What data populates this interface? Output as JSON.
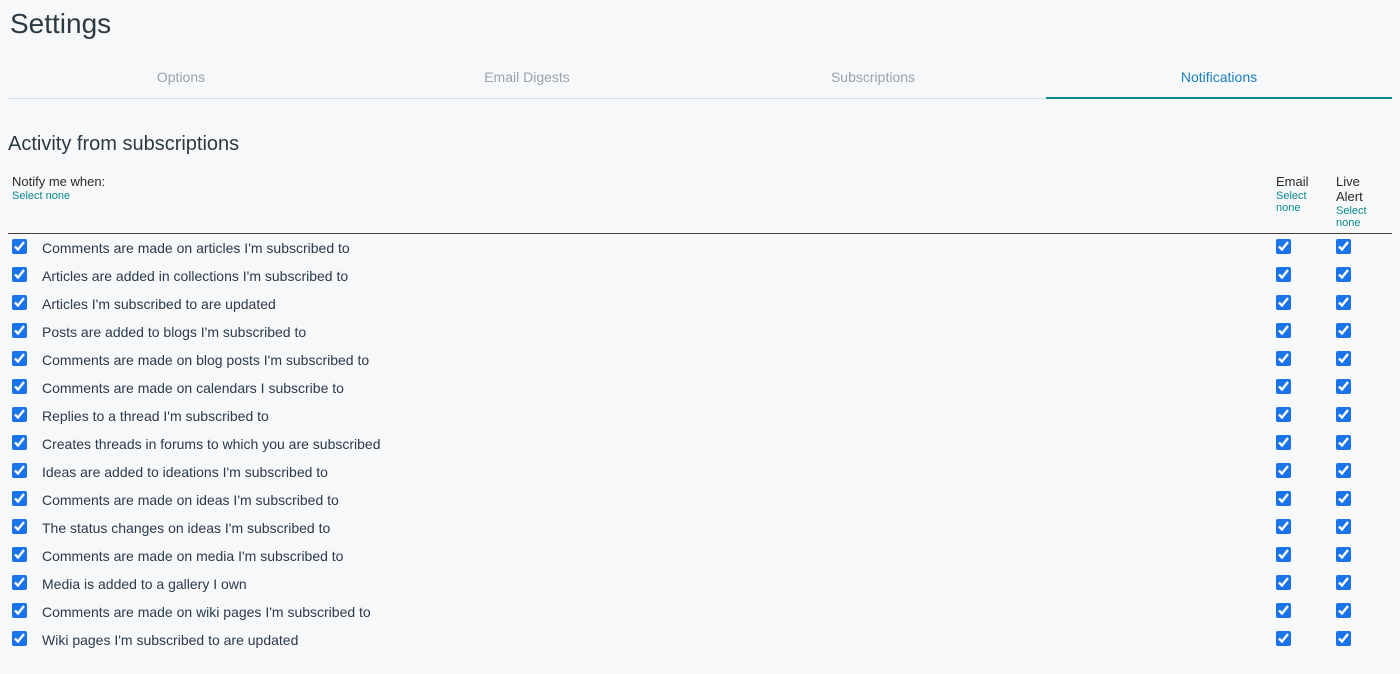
{
  "page_title": "Settings",
  "tabs": [
    {
      "label": "Options",
      "active": false
    },
    {
      "label": "Email Digests",
      "active": false
    },
    {
      "label": "Subscriptions",
      "active": false
    },
    {
      "label": "Notifications",
      "active": true
    }
  ],
  "section_title": "Activity from subscriptions",
  "header": {
    "notify_label": "Notify me when:",
    "email_label": "Email",
    "live_label": "Live Alert",
    "select_none": "Select none"
  },
  "rows": [
    {
      "label": "Comments are made on articles I'm subscribed to",
      "master": true,
      "email": true,
      "live": true
    },
    {
      "label": "Articles are added in collections I'm subscribed to",
      "master": true,
      "email": true,
      "live": true
    },
    {
      "label": "Articles I'm subscribed to are updated",
      "master": true,
      "email": true,
      "live": true
    },
    {
      "label": "Posts are added to blogs I'm subscribed to",
      "master": true,
      "email": true,
      "live": true
    },
    {
      "label": "Comments are made on blog posts I'm subscribed to",
      "master": true,
      "email": true,
      "live": true
    },
    {
      "label": "Comments are made on calendars I subscribe to",
      "master": true,
      "email": true,
      "live": true
    },
    {
      "label": "Replies to a thread I'm subscribed to",
      "master": true,
      "email": true,
      "live": true
    },
    {
      "label": "Creates threads in forums to which you are subscribed",
      "master": true,
      "email": true,
      "live": true
    },
    {
      "label": "Ideas are added to ideations I'm subscribed to",
      "master": true,
      "email": true,
      "live": true
    },
    {
      "label": "Comments are made on ideas I'm subscribed to",
      "master": true,
      "email": true,
      "live": true
    },
    {
      "label": "The status changes on ideas I'm subscribed to",
      "master": true,
      "email": true,
      "live": true
    },
    {
      "label": "Comments are made on media I'm subscribed to",
      "master": true,
      "email": true,
      "live": true
    },
    {
      "label": "Media is added to a gallery I own",
      "master": true,
      "email": true,
      "live": true
    },
    {
      "label": "Comments are made on wiki pages I'm subscribed to",
      "master": true,
      "email": true,
      "live": true
    },
    {
      "label": "Wiki pages I'm subscribed to are updated",
      "master": true,
      "email": true,
      "live": true
    }
  ]
}
